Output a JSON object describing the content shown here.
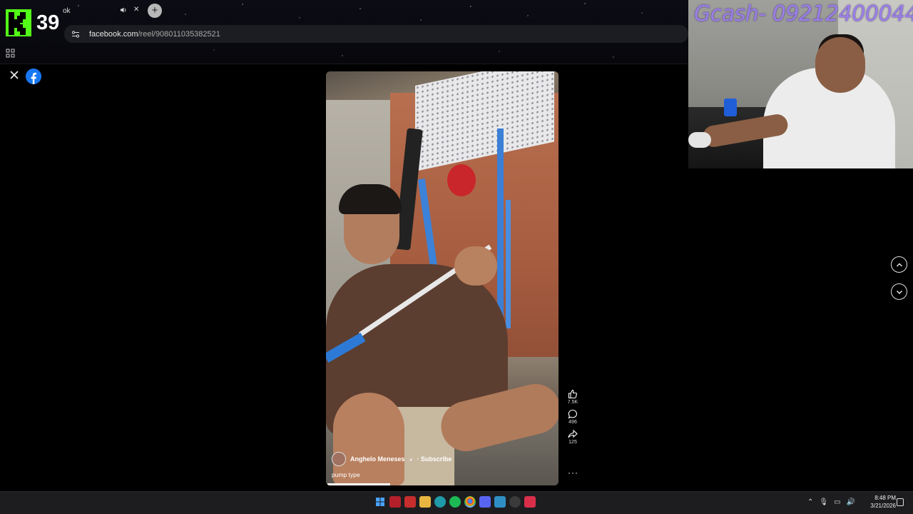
{
  "stream_overlay": {
    "viewer_count": "39",
    "donation_text": "Gcash- 09212400044"
  },
  "browser": {
    "tab_label": "ok",
    "address": {
      "domain": "facebook.com",
      "path": "/reel/908011035382521"
    }
  },
  "reel": {
    "author": "Anghelo Meneses",
    "subscribe_label": "· Subscribe",
    "caption": "pump type",
    "likes": "7.5K",
    "comments": "496",
    "shares": "125",
    "more_label": "···"
  },
  "taskbar": {
    "time": "8:48 PM",
    "date": "3/21/2026"
  },
  "colors": {
    "kick_green": "#53fc18",
    "facebook_blue": "#1877f2",
    "gcash_purple": "#9b7fe8"
  }
}
